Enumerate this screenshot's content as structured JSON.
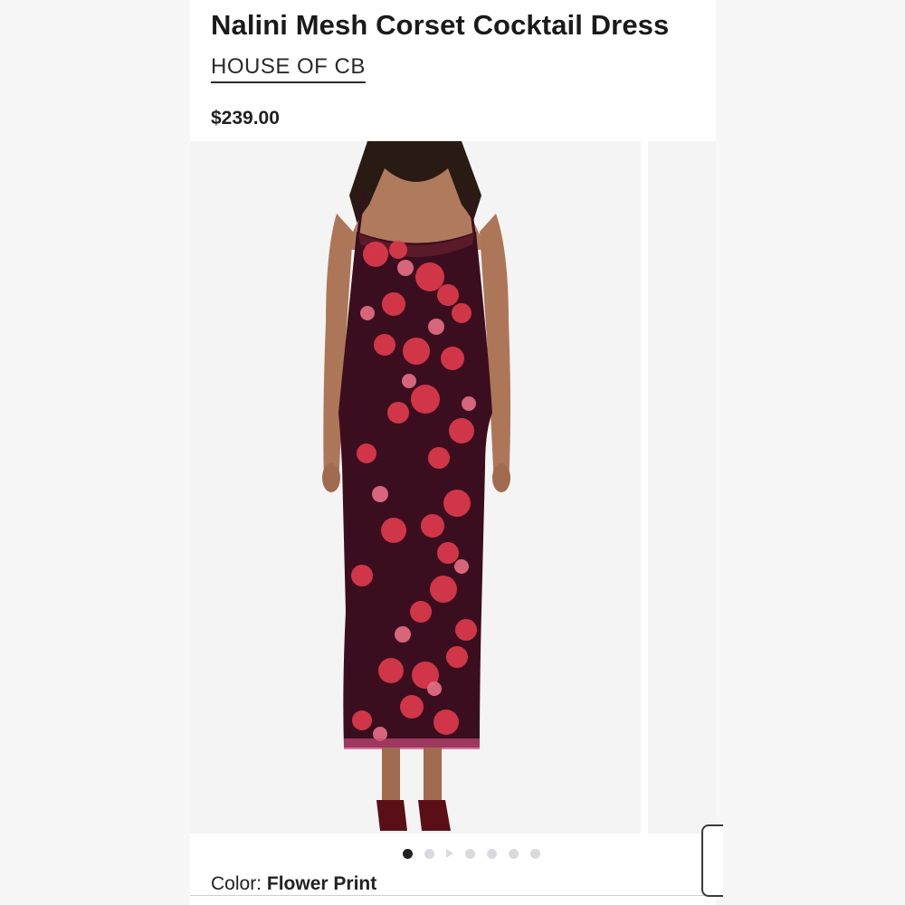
{
  "product": {
    "title": "Nalini Mesh Corset Cocktail Dress",
    "brand": "HOUSE OF CB",
    "price": "$239.00"
  },
  "gallery": {
    "image_alt": "Model wearing floral mesh corset maxi dress",
    "dot_count": 7,
    "active_dot": 1,
    "video_dot": 3
  },
  "color": {
    "label": "Color:",
    "value": "Flower Print"
  },
  "palette": {
    "dress_base": "#3a0e1f",
    "rose": "#d9394a",
    "accent_pink": "#e86f86"
  }
}
